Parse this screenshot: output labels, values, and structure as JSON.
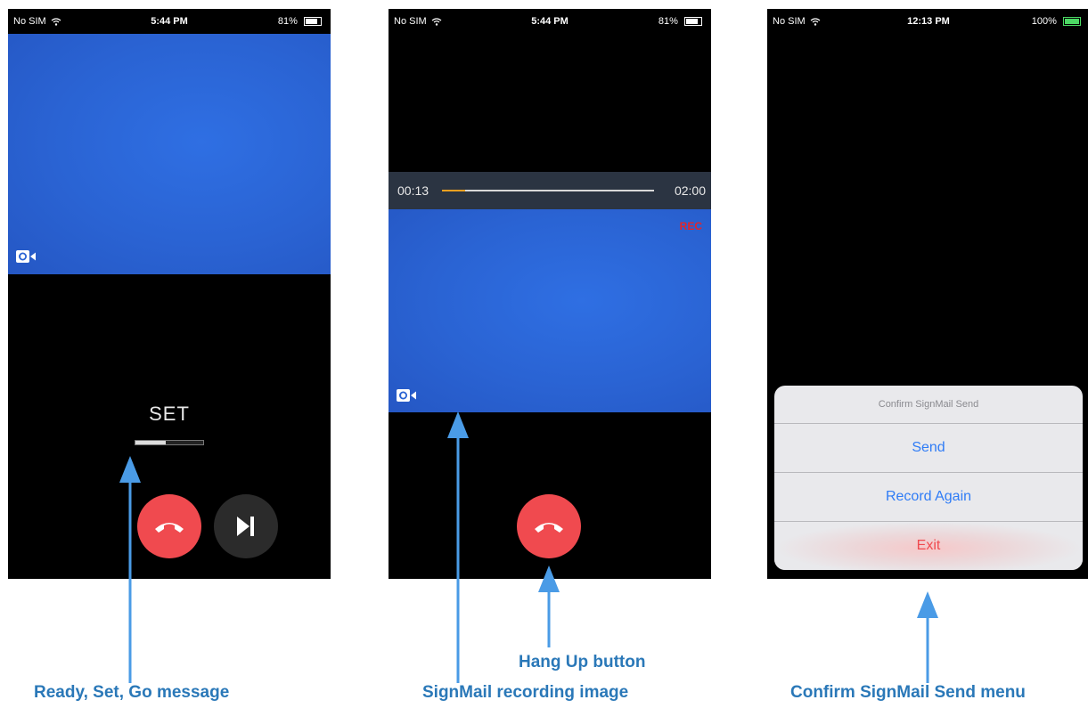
{
  "colors": {
    "accent_blue": "#2f7cf6",
    "hang_red": "#f04a4f",
    "rec_red": "#e3252a",
    "caption_blue": "#2a78b8",
    "arrow_blue": "#4a9be6",
    "progress_orange": "#f0a020"
  },
  "screens": [
    {
      "status": {
        "carrier": "No SIM",
        "time": "5:44 PM",
        "battery": "81%"
      },
      "message": "SET",
      "countdown_progress": 0.45,
      "icons": [
        "camera-switch-icon",
        "hang-up-icon",
        "skip-forward-icon"
      ]
    },
    {
      "status": {
        "carrier": "No SIM",
        "time": "5:44 PM",
        "battery": "81%"
      },
      "elapsed": "00:13",
      "total": "02:00",
      "recording_progress": 0.11,
      "rec_label": "REC",
      "icons": [
        "camera-switch-icon",
        "hang-up-icon"
      ]
    },
    {
      "status": {
        "carrier": "No SIM",
        "time": "12:13 PM",
        "battery": "100%"
      },
      "menu": {
        "title": "Confirm SignMail Send",
        "items": [
          "Send",
          "Record Again",
          "Exit"
        ]
      }
    }
  ],
  "captions": {
    "left": "Ready, Set, Go message",
    "middle_top": "Hang Up button",
    "middle": "SignMail recording image",
    "right": "Confirm SignMail Send menu"
  }
}
